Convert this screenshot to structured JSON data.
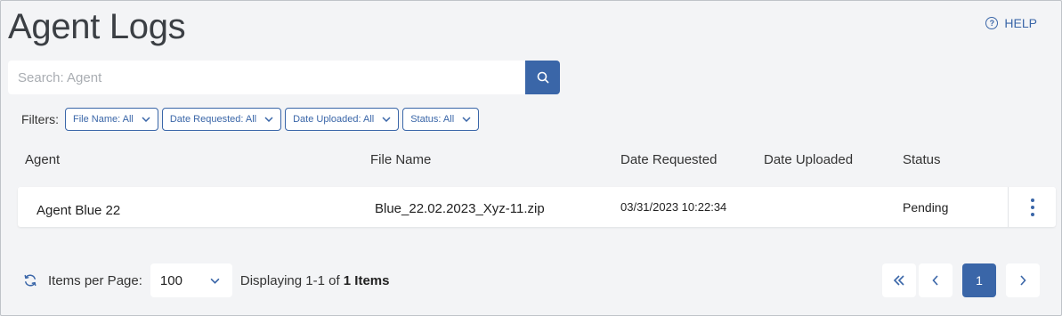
{
  "page": {
    "title": "Agent Logs"
  },
  "help": {
    "label": "HELP",
    "icon": "question-circle-icon"
  },
  "search": {
    "placeholder": "Search: Agent",
    "value": "",
    "icon": "search-icon"
  },
  "filters": {
    "label": "Filters:",
    "chips": [
      {
        "label": "File Name: All"
      },
      {
        "label": "Date Requested: All"
      },
      {
        "label": "Date Uploaded: All"
      },
      {
        "label": "Status: All"
      }
    ]
  },
  "table": {
    "columns": [
      "Agent",
      "File Name",
      "Date Requested",
      "Date Uploaded",
      "Status"
    ],
    "rows": [
      {
        "agent": "Agent Blue 22",
        "file_name": "Blue_22.02.2023_Xyz-11.zip",
        "date_requested": "03/31/2023 10:22:34",
        "date_uploaded": "",
        "status": "Pending"
      }
    ]
  },
  "footer": {
    "items_per_page_label": "Items per Page:",
    "items_per_page_value": "100",
    "displaying_prefix": "Displaying 1-1 of",
    "displaying_total": "1 Items"
  },
  "pagination": {
    "first_icon": "double-chevron-left-icon",
    "prev_icon": "chevron-left-icon",
    "current_page": "1",
    "next_icon": "chevron-right-icon"
  },
  "colors": {
    "accent": "#3a66a8",
    "background": "#f3f4f6"
  }
}
